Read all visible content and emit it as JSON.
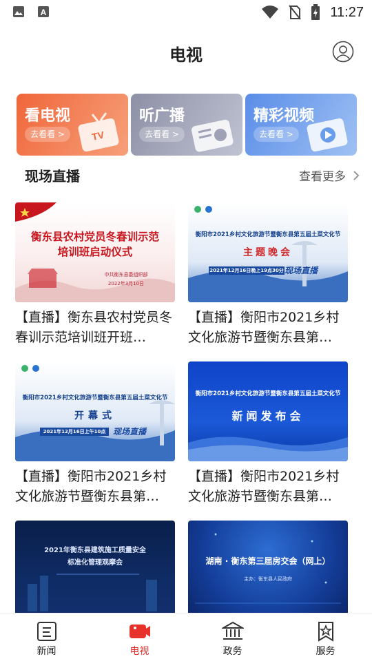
{
  "status_bar": {
    "time": "11:27",
    "left_icons": [
      "image-icon",
      "font-a-icon"
    ],
    "right_icons": [
      "wifi-icon",
      "no-sim-icon",
      "battery-charging-icon"
    ]
  },
  "header": {
    "title": "电视",
    "user_icon": "user-circle-icon"
  },
  "entries": [
    {
      "title": "看电视",
      "go": "去看看 >",
      "icon": "tv-icon",
      "color": "#f0663a"
    },
    {
      "title": "听广播",
      "go": "去看看 >",
      "icon": "radio-icon",
      "color": "#8d90a6"
    },
    {
      "title": "精彩视频",
      "go": "去看看 >",
      "icon": "video-play-icon",
      "color": "#5a8de8"
    }
  ],
  "section": {
    "title": "现场直播",
    "more": "查看更多"
  },
  "cards": [
    {
      "title": "【直播】衡东县农村党员冬春训示范培训班开班…",
      "thumb": {
        "line1": "衡东县农村党员冬春训示范",
        "line2": "培训班启动仪式",
        "line3": "中共衡东县委组织部",
        "line4": "2022年3月10日"
      }
    },
    {
      "title": "【直播】衡阳市2021乡村文化旅游节暨衡东县第…",
      "thumb": {
        "line1": "衡阳市2021乡村文化旅游节暨衡东县第五届土菜文化节",
        "line2": "主题晚会",
        "line3": "2021年12月16日晚上19点30分",
        "line4": "现场直播"
      }
    },
    {
      "title": "【直播】衡阳市2021乡村文化旅游节暨衡东县第…",
      "thumb": {
        "line1": "衡阳市2021乡村文化旅游节暨衡东县第五届土菜文化节",
        "line2": "开幕式",
        "line3": "2021年12月16日上午10点",
        "line4": "现场直播"
      }
    },
    {
      "title": "【直播】衡阳市2021乡村文化旅游节暨衡东县第…",
      "thumb": {
        "line1": "衡阳市2021乡村文化旅游节暨衡东县第五届土菜文化节",
        "line2": "新闻发布会"
      }
    },
    {
      "title": "",
      "thumb": {
        "line1": "2021年衡东县建筑施工质量安全",
        "line2": "标准化管理观摩会"
      }
    },
    {
      "title": "",
      "thumb": {
        "line1": "湖南 · 衡东第三届房交会（网上）",
        "line2": "主办：衡东县人民政府"
      }
    }
  ],
  "bottom_nav": [
    {
      "label": "新闻",
      "icon": "news-icon",
      "active": false
    },
    {
      "label": "电视",
      "icon": "tv-camera-icon",
      "active": true
    },
    {
      "label": "政务",
      "icon": "government-building-icon",
      "active": false
    },
    {
      "label": "服务",
      "icon": "bookmark-star-icon",
      "active": false
    }
  ],
  "colors": {
    "accent": "#e8312a",
    "text": "#222222"
  }
}
